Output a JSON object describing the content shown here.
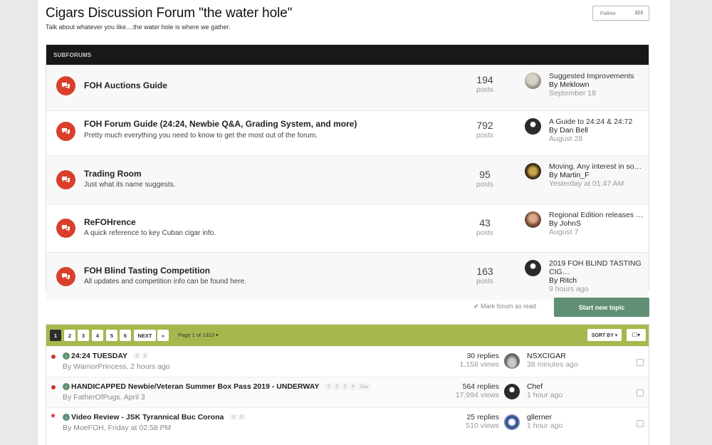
{
  "forum": {
    "title": "Cigars Discussion Forum \"the water hole\"",
    "description": "Talk about whatever you like....the water hole is where we gather.",
    "follow_label": "Follow",
    "follow_count": "323"
  },
  "subforums": {
    "header": "SUBFORUMS",
    "items": [
      {
        "name": "FOH Auctions Guide",
        "desc": "",
        "posts": "194",
        "posts_label": "posts",
        "last_title": "Suggested Improvements",
        "last_by": "By Meklown",
        "last_when": "September 18"
      },
      {
        "name": "FOH Forum Guide (24:24, Newbie Q&A, Grading System, and more)",
        "desc": "Pretty much everything you need to know to get the most out of the forum.",
        "posts": "792",
        "posts_label": "posts",
        "last_title": "A Guide to 24:24 & 24:72",
        "last_by": "By Dan Bell",
        "last_when": "August 28"
      },
      {
        "name": "Trading Room",
        "desc": "Just what its name suggests.",
        "posts": "95",
        "posts_label": "posts",
        "last_title": "Moving. Any interest in so…",
        "last_by": "By Martin_F",
        "last_when": "Yesterday at 01:47 AM"
      },
      {
        "name": "ReFOHrence",
        "desc": "A quick reference to key Cuban cigar info.",
        "posts": "43",
        "posts_label": "posts",
        "last_title": "Regional Edition releases …",
        "last_by": "By JohnS",
        "last_when": "August 7"
      },
      {
        "name": "FOH Blind Tasting Competition",
        "desc": "All updates and competition info can be found here.",
        "posts": "163",
        "posts_label": "posts",
        "last_title": "2019 FOH BLIND TASTING CIG…",
        "last_by": "By Ritch",
        "last_when": "9 hours ago"
      }
    ]
  },
  "actions": {
    "mark_read": "✔ Mark forum as read",
    "start_topic": "Start new topic"
  },
  "pagination": {
    "pages": [
      "1",
      "2",
      "3",
      "4",
      "5",
      "6"
    ],
    "next": "NEXT",
    "last": "»",
    "page_of": "Page 1 of 1323 ▾",
    "sort_by": "SORT BY ▾",
    "select": "☐▾"
  },
  "topics": [
    {
      "title": "24:24 TUESDAY",
      "mini_pages": [
        "1",
        "2"
      ],
      "by": "By WarriorPrincess, 2 hours ago",
      "replies": "30 replies",
      "views": "1,158 views",
      "last_user": "NSXCIGAR",
      "last_when": "38 minutes ago",
      "marker": "dot"
    },
    {
      "title": "HANDICAPPED Newbie/Veteran Summer Box Pass 2019 - UNDERWAY",
      "mini_pages": [
        "1",
        "2",
        "3",
        "4",
        "24 ▸"
      ],
      "by": "By FatherOfPugs, April 3",
      "replies": "564 replies",
      "views": "17,994 views",
      "last_user": "Chef",
      "last_when": "1 hour ago",
      "marker": "dot"
    },
    {
      "title": "Video Review - JSK Tyrannical Buc Corona",
      "mini_pages": [
        "1",
        "2"
      ],
      "by": "By MoeFOH, Friday at 02:58 PM",
      "replies": "25 replies",
      "views": "510 views",
      "last_user": "gllerner",
      "last_when": "1 hour ago",
      "marker": "star"
    }
  ]
}
